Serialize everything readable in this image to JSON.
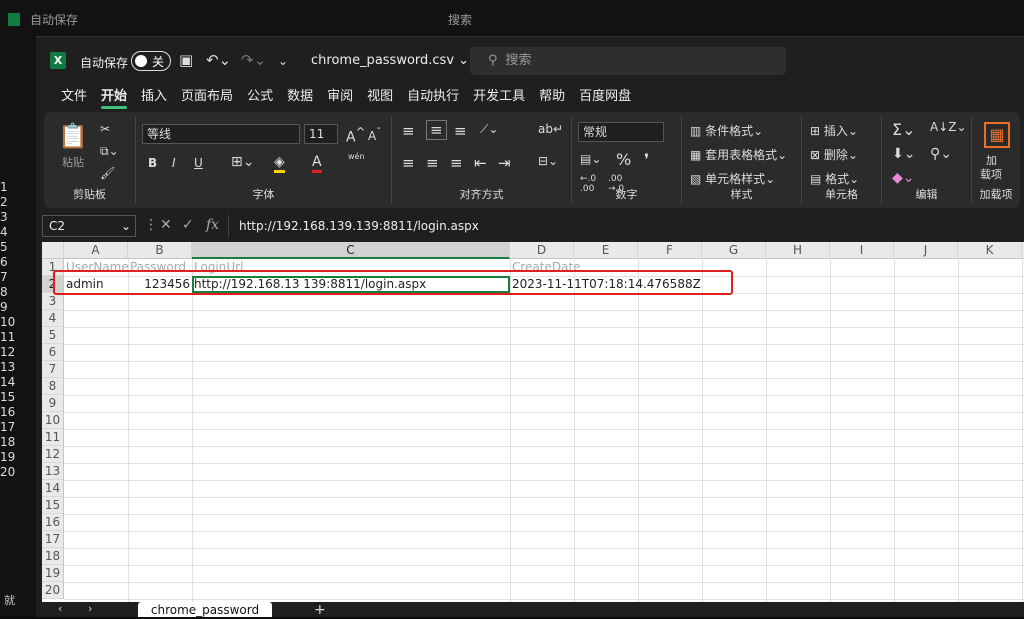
{
  "background_window": {
    "autosave_label": "自动保存",
    "search_label": "搜索",
    "row_numbers": [
      "1",
      "2",
      "3",
      "4",
      "5",
      "6",
      "7",
      "8",
      "9",
      "10",
      "11",
      "12",
      "13",
      "14",
      "15",
      "16",
      "17",
      "18",
      "19",
      "20"
    ],
    "status_left": "就"
  },
  "titlebar": {
    "autosave_label": "自动保存",
    "toggle_state": "关",
    "filename": "chrome_password.csv",
    "search_placeholder": "搜索",
    "undo_icon": "undo-icon",
    "save_icon": "save-icon"
  },
  "ribbon_tabs": [
    "文件",
    "开始",
    "插入",
    "页面布局",
    "公式",
    "数据",
    "审阅",
    "视图",
    "自动执行",
    "开发工具",
    "帮助",
    "百度网盘"
  ],
  "active_tab": "开始",
  "ribbon": {
    "clipboard": {
      "label": "剪贴板",
      "paste": "粘贴"
    },
    "font": {
      "label": "字体",
      "font_name": "等线",
      "font_size": "11",
      "bold": "B",
      "italic": "I",
      "underline": "U",
      "phonetic": "wén"
    },
    "alignment": {
      "label": "对齐方式"
    },
    "number": {
      "label": "数字",
      "format": "常规",
      "percent": "%"
    },
    "styles": {
      "label": "样式",
      "conditional": "条件格式",
      "table": "套用表格格式",
      "cell_styles": "单元格样式"
    },
    "cells": {
      "label": "单元格",
      "insert": "插入",
      "delete": "删除",
      "format": "格式"
    },
    "editing": {
      "label": "编辑"
    },
    "addins": {
      "label": "加载项",
      "button_line1": "加",
      "button_line2": "载项"
    }
  },
  "formula_bar": {
    "name_box": "C2",
    "fx": "fx",
    "formula": "http://192.168.139.139:8811/login.aspx"
  },
  "sheet": {
    "columns": [
      "A",
      "B",
      "C",
      "D",
      "E",
      "F",
      "G",
      "H",
      "I",
      "J",
      "K"
    ],
    "selected_column": "C",
    "rows": [
      "1",
      "2",
      "3",
      "4",
      "5",
      "6",
      "7",
      "8",
      "9",
      "10",
      "11",
      "12",
      "13",
      "14",
      "15",
      "16",
      "17",
      "18",
      "19",
      "20"
    ],
    "selected_row": "2",
    "headers": {
      "A": "UserName",
      "B": "Password",
      "C": "LoginUrl",
      "D": "CreateDate"
    },
    "data": {
      "A": "admin",
      "B": "123456",
      "C": "http://192.168.13 139:8811/login.aspx",
      "D": "2023-11-11T07:18:14.476588Z"
    }
  },
  "sheet_tabs": {
    "active": "chrome_password",
    "add": "+"
  },
  "colors": {
    "excel_green": "#107c41",
    "selection_green": "#1a7d3c",
    "highlight_red": "#e02020"
  }
}
